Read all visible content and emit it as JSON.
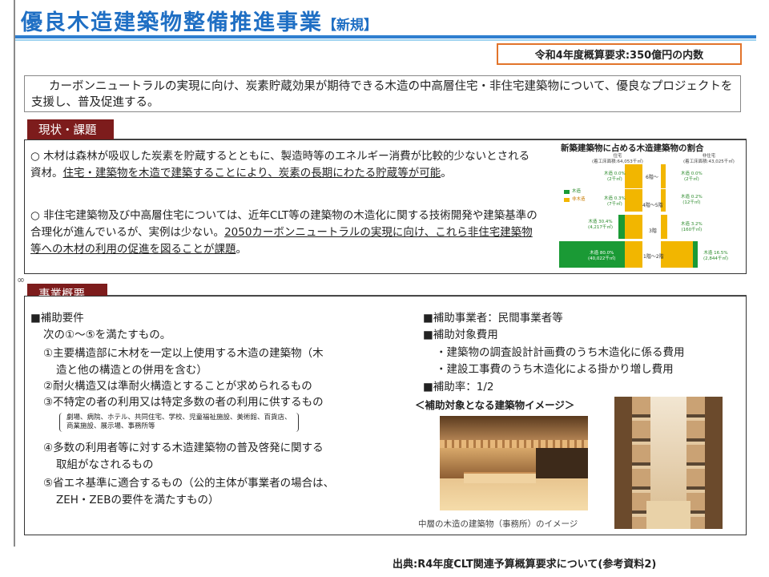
{
  "header": {
    "title": "優良木造建築物整備推進事業",
    "tag": "【新規】",
    "budget": "令和4年度概算要求:350億円の内数"
  },
  "intro": "カーボンニュートラルの実現に向け、炭素貯蔵効果が期待できる木造の中高層住宅・非住宅建築物について、優良なプロジェクトを支援し、普及促進する。",
  "status_section": {
    "heading": "現状・課題",
    "p1_plain": "○ 木材は森林が吸収した炭素を貯蔵するとともに、製造時等のエネルギー消費が比較的少ないとされる資材。",
    "p1_underline": "住宅・建築物を木造で建築することにより、炭素の長期にわたる貯蔵等が可能",
    "p1_end": "。",
    "p2_plain": "○ 非住宅建築物及び中高層住宅については、近年CLT等の建築物の木造化に関する技術開発や建築基準の合理化が進んでいるが、実例は少ない。",
    "p2_underline": "2050カーボンニュートラルの実現に向け、これら非住宅建築物等への木材の利用の促進を図ることが課題",
    "p2_end": "。"
  },
  "chart": {
    "title": "新築建築物に占める木造建築物の割合",
    "left_header": "住宅",
    "left_sub": "(着工床面積:64,053千㎡)",
    "right_header": "非住宅",
    "right_sub": "(着工床面積:43,025千㎡)",
    "legend_wood": "木造",
    "legend_nonwood": "非木造",
    "floors": [
      "6階～",
      "4階～5階",
      "3階",
      "1階～2階"
    ],
    "left_labels": [
      [
        "木造 0.0%",
        "(2千㎡)"
      ],
      [
        "木造 0.3%",
        "(7千㎡)"
      ],
      [
        "木造 30.4%",
        "(4,217千㎡)"
      ],
      [
        "木造 80.0%",
        "(40,022千㎡)"
      ]
    ],
    "right_labels": [
      [
        "木造 0.0%",
        "(2千㎡)"
      ],
      [
        "木造 0.2%",
        "(12千㎡)"
      ],
      [
        "木造 3.2%",
        "(160千㎡)"
      ],
      [
        "木造 16.5%",
        "(2,844千㎡)"
      ]
    ]
  },
  "chart_data": {
    "type": "bar",
    "title": "新築建築物に占める木造建築物の割合",
    "categories": [
      "6階～",
      "4階～5階",
      "3階",
      "1階～2階"
    ],
    "series": [
      {
        "name": "住宅",
        "values": [
          0.0,
          0.3,
          30.4,
          80.0
        ]
      },
      {
        "name": "非住宅",
        "values": [
          0.0,
          0.2,
          3.2,
          16.5
        ]
      }
    ]
  },
  "overview_section": {
    "heading": "事業概要",
    "left": {
      "req_title": "■補助要件",
      "req_intro": "次の①～⑤を満たすもの。",
      "item1a": "①主要構造部に木材を一定以上使用する木造の建築物（木",
      "item1b": "造と他の構造との併用を含む）",
      "item2": "②耐火構造又は準耐火構造とすることが求められるもの",
      "item3": "③不特定の者の利用又は特定多数の者の利用に供するもの",
      "bracket_a": "劇場、病院、ホテル、共同住宅、学校、児童福祉施設、美術館、百貨店、",
      "bracket_b": "商業施設、展示場、事務所等",
      "item4a": "④多数の利用者等に対する木造建築物の普及啓発に関する",
      "item4b": "取組がなされるもの",
      "item5a": "⑤省エネ基準に適合するもの（公的主体が事業者の場合は、",
      "item5b": "ZEH・ZEBの要件を満たすもの）"
    },
    "right": {
      "operator": "■補助事業者：民間事業者等",
      "costs_title": "■補助対象費用",
      "cost1": "・建築物の調査設計計画費のうち木造化に係る費用",
      "cost2": "・建設工事費のうち木造化による掛かり増し費用",
      "rate": "■補助率：1/2",
      "image_title": "＜補助対象となる建築物イメージ＞",
      "caption": "中層の木造の建築物（事務所）のイメージ"
    }
  },
  "source": "出典:R4年度CLT関連予算概算要求について(参考資料2)",
  "colors": {
    "title_blue": "#1f6fc4",
    "section_tab": "#7d1c1c",
    "budget_border": "#e2742b",
    "wood_green": "#1a9a35",
    "nonwood_orange": "#f2b600"
  }
}
